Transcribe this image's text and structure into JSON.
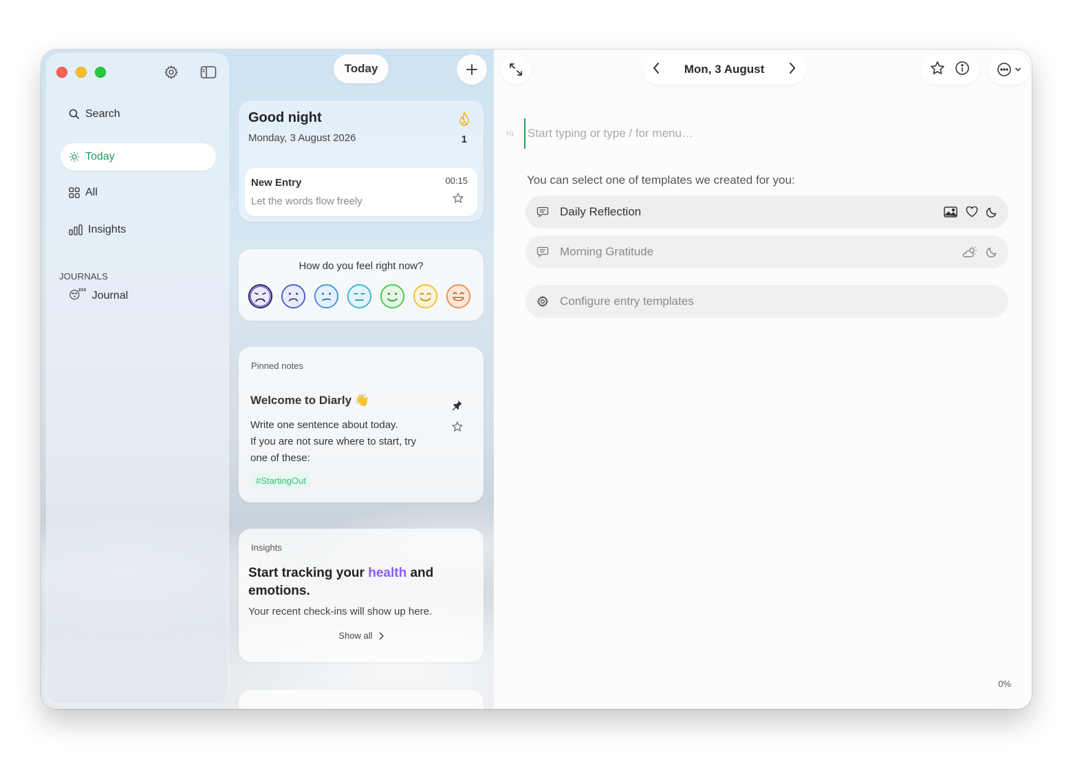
{
  "sidebar": {
    "search_label": "Search",
    "nav": [
      {
        "label": "Today",
        "icon": "sun-icon",
        "active": true
      },
      {
        "label": "All",
        "icon": "grid-icon",
        "active": false
      },
      {
        "label": "Insights",
        "icon": "bar-chart-icon",
        "active": false
      }
    ],
    "section_label": "JOURNALS",
    "journals": [
      {
        "label": "Journal",
        "emoji": "😴"
      }
    ]
  },
  "timeline": {
    "today_button": "Today",
    "greeting": {
      "title": "Good night",
      "date": "Monday, 3 August 2026",
      "streak": "1"
    },
    "entry": {
      "title": "New Entry",
      "preview": "Let the words flow freely",
      "time": "00:15"
    },
    "mood": {
      "question": "How do you feel right now?",
      "levels": [
        {
          "name": "very-sad",
          "color": "#6b4fc9"
        },
        {
          "name": "sad",
          "color": "#4a57c8"
        },
        {
          "name": "meh",
          "color": "#3c8de0"
        },
        {
          "name": "neutral",
          "color": "#2fb4d2"
        },
        {
          "name": "content",
          "color": "#3fc64a"
        },
        {
          "name": "happy",
          "color": "#f0c02c"
        },
        {
          "name": "very-happy",
          "color": "#f28a4e"
        }
      ]
    },
    "pinned": {
      "section": "Pinned notes",
      "title": "Welcome to Diarly 👋",
      "body_line1": "Write one sentence about today.",
      "body_line2": "If you are not sure where to start, try one of these:",
      "tag": "#StartingOut"
    },
    "insights": {
      "section": "Insights",
      "title_pre": "Start tracking your ",
      "title_highlight": "health",
      "title_post": " and emotions.",
      "subtitle": "Your recent check-ins will show up here.",
      "show_all": "Show all"
    }
  },
  "editor": {
    "date": "Mon, 3 August",
    "heading_marker": "H1",
    "placeholder": "Start typing or type / for menu…",
    "templates_hint": "You can select one of templates we created for you:",
    "templates": [
      {
        "label": "Daily Reflection"
      },
      {
        "label": "Morning Gratitude"
      }
    ],
    "configure_label": "Configure entry templates",
    "progress": "0%"
  },
  "colors": {
    "accent": "#1d9a63",
    "tag_green": "#2ec27e",
    "highlight_purple": "#8b5cf6"
  }
}
